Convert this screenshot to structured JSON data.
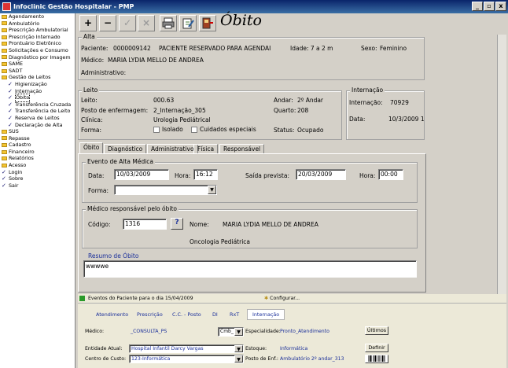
{
  "window": {
    "title": "Infoclinic Gestão Hospitalar - PMP",
    "buttons": [
      "_",
      "▫",
      "x"
    ]
  },
  "tree": [
    {
      "label": "Agendamento",
      "kind": "folder"
    },
    {
      "label": "Ambulatório",
      "kind": "folder"
    },
    {
      "label": "Prescrição Ambulatorial",
      "kind": "folder"
    },
    {
      "label": "Prescrição Internado",
      "kind": "folder"
    },
    {
      "label": "Prontuário Eletrônico",
      "kind": "folder"
    },
    {
      "label": "Solicitações e Consumo",
      "kind": "folder"
    },
    {
      "label": "Diagnóstico por Imagem",
      "kind": "folder"
    },
    {
      "label": "SAME",
      "kind": "folder"
    },
    {
      "label": "SADT",
      "kind": "folder"
    },
    {
      "label": "Gestão de Leitos",
      "kind": "folder"
    },
    {
      "label": "Higienização",
      "kind": "check",
      "indent": 1
    },
    {
      "label": "Internação",
      "kind": "check",
      "indent": 1
    },
    {
      "label": "Óbito",
      "kind": "check",
      "indent": 1,
      "selected": true
    },
    {
      "label": "Transferência Cruzada",
      "kind": "check",
      "indent": 1
    },
    {
      "label": "Transferência de Leito",
      "kind": "check",
      "indent": 1
    },
    {
      "label": "Reserva de Leitos",
      "kind": "check",
      "indent": 1
    },
    {
      "label": "Declaração de Alta",
      "kind": "check",
      "indent": 1
    },
    {
      "label": "SUS",
      "kind": "folder"
    },
    {
      "label": "Repasse",
      "kind": "folder"
    },
    {
      "label": "Cadastro",
      "kind": "folder"
    },
    {
      "label": "Financeiro",
      "kind": "folder"
    },
    {
      "label": "Relatórios",
      "kind": "folder"
    },
    {
      "label": "Acesso",
      "kind": "folder"
    },
    {
      "label": "Login",
      "kind": "check"
    },
    {
      "label": "Sobre",
      "kind": "check"
    },
    {
      "label": "Sair",
      "kind": "check"
    }
  ],
  "toolbar": {
    "add": "+",
    "remove": "−",
    "confirm": "✓",
    "cancel": "×",
    "form_title": "Óbito"
  },
  "alta": {
    "group": "Alta",
    "paciente_label": "Paciente:",
    "paciente_id": "0000009142",
    "paciente_nome": "PACIENTE RESERVADO PARA AGENDAI",
    "idade": "Idade: 7 a 2 m",
    "sexo_label": "Sexo:",
    "sexo": "Feminino",
    "medico_label": "Médico:",
    "medico": "MARIA LYDIA MELLO DE ANDREA",
    "administrativo_label": "Administrativo:"
  },
  "leito": {
    "group": "Leito",
    "leito_label": "Leito:",
    "leito": "000.63",
    "andar_label": "Andar:",
    "andar": "2º Andar",
    "posto_label": "Posto de enfermagem:",
    "posto": "2_Internação_305",
    "quarto_label": "Quarto:",
    "quarto": "208",
    "clinica_label": "Clínica:",
    "clinica": "Urologia Pediátrical",
    "forma_label": "Forma:",
    "isolado": "Isolado",
    "cuidados": "Cuidados especiais",
    "status_label": "Status:",
    "status": "Ocupado"
  },
  "internacao": {
    "group": "Internação",
    "internacao_label": "Internação:",
    "internacao": "70929",
    "data_label": "Data:",
    "data": "10/3/2009 1"
  },
  "tabs": [
    "Óbito",
    "Diagnóstico",
    "Administrativo",
    "Física",
    "Responsável"
  ],
  "evento": {
    "group": "Evento de Alta Médica",
    "data_label": "Data:",
    "data": "10/03/2009",
    "hora_label": "Hora:",
    "hora": "16:12",
    "saida_label": "Saída prevista:",
    "saida": "20/03/2009",
    "hora2_label": "Hora:",
    "hora2": "00:00",
    "forma_label": "Forma:",
    "forma": ""
  },
  "medico_obito": {
    "group": "Médico responsável pelo óbito",
    "codigo_label": "Código:",
    "codigo": "1316",
    "lookup": "?",
    "nome_label": "Nome:",
    "nome": "MARIA LYDIA MELLO DE ANDREA",
    "especialidade": "Oncologia Pediátrica"
  },
  "resumo": {
    "group": "Resumo de Óbito",
    "text": "wwwwe"
  },
  "bottom": {
    "events_title": "Eventos do Paciente para o dia 15/04/2009",
    "configurar": "Configurar...",
    "subtabs": [
      "Atendimento",
      "Prescrição",
      "C.C. - Posto",
      "DI",
      "RxT",
      "Internação"
    ],
    "medico_label": "Médico:",
    "medico": "_CONSULTA_PS",
    "crm": "Cmb_",
    "esp_label": "Especialidade:",
    "esp": "Pronto_Atendimento",
    "ultimos": "Últimos",
    "entidade_label": "Entidade Atual:",
    "entidade": "Hospital Infantil Darcy Vargas",
    "estoque_label": "Estoque:",
    "estoque": "Informática",
    "definir": "Definir",
    "centro_label": "Centro de Custo:",
    "centro": "123-Informática",
    "posto_label": "Posto de Enf.:",
    "posto": "Ambulatório 2º andar_313"
  }
}
